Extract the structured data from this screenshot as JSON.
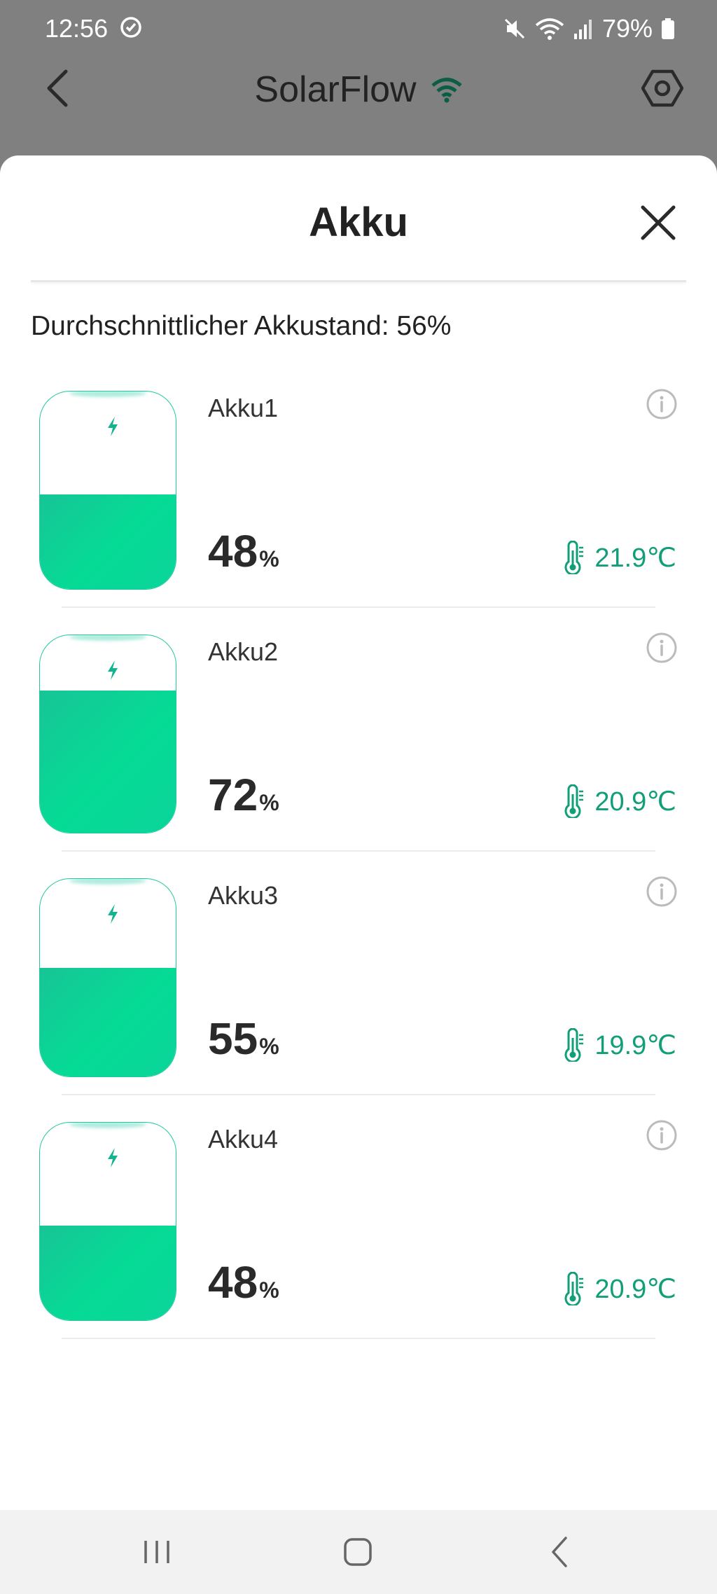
{
  "status_bar": {
    "time": "12:56",
    "battery_percent": "79%"
  },
  "header": {
    "title": "SolarFlow"
  },
  "sheet": {
    "title": "Akku",
    "average_label": "Durchschnittlicher Akkustand: 56%"
  },
  "batteries": [
    {
      "name": "Akku1",
      "percent": "48",
      "unit": "%",
      "temperature": "21.9℃",
      "level": 0.48
    },
    {
      "name": "Akku2",
      "percent": "72",
      "unit": "%",
      "temperature": "20.9℃",
      "level": 0.72
    },
    {
      "name": "Akku3",
      "percent": "55",
      "unit": "%",
      "temperature": "19.9℃",
      "level": 0.55
    },
    {
      "name": "Akku4",
      "percent": "48",
      "unit": "%",
      "temperature": "20.9℃",
      "level": 0.48
    }
  ],
  "colors": {
    "accent": "#0fd49a",
    "temperature": "#119e78",
    "overlay": "#808080"
  },
  "icons": {
    "alarm": "alarm-icon",
    "mute": "mute-icon",
    "wifi": "wifi-icon",
    "signal": "signal-icon",
    "battery": "battery-icon",
    "back": "chevron-left-icon",
    "settings": "hexagon-settings-icon",
    "close": "close-icon",
    "info": "info-icon",
    "thermometer": "thermometer-icon",
    "bolt": "bolt-icon",
    "nav_recent": "recent-apps-icon",
    "nav_home": "home-icon",
    "nav_back": "back-icon"
  }
}
